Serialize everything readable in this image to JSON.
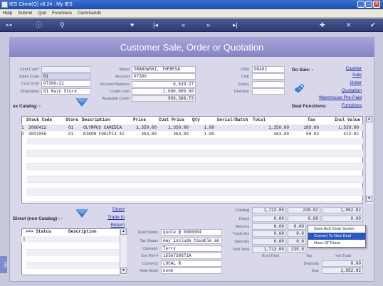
{
  "window": {
    "title": "IES Client(Q) v8.24 : My IES",
    "min": "_",
    "max": "□",
    "close": "×"
  },
  "menu": [
    "Help",
    "Submit",
    "Quit",
    "Functions",
    "Commands"
  ],
  "toolbar_icons": [
    "key-icon",
    "info-icon",
    "search-icon",
    "heart-icon",
    "first-icon",
    "rewind-icon",
    "forward-icon",
    "last-icon",
    "plus-icon",
    "cross-icon",
    "check-icon"
  ],
  "header": {
    "title": "Customer Sale, Order or Quotation"
  },
  "form": {
    "find_cust_label": "Find Cust?",
    "sales_code_label": "Sales Code",
    "sales_code": "01",
    "cust_ord_label": "Cust Ord#",
    "cust_ord": "07306/22",
    "origination_label": "Origination",
    "origination": "01 Main Store",
    "name_label": "Name",
    "name": "GRABOWSKI, THERESA",
    "account_label": "Account",
    "account": "07306",
    "acct_balance_label": "Account Balance",
    "acct_balance": "6,639.27",
    "credit_limit_label": "Credit Limit",
    "credit_limit": "1,000,000.00",
    "available_label": "Available Credit",
    "available": "993,360.73",
    "crm_label": "CRM",
    "crm": "08492",
    "club_label": "Club",
    "expiry_label": "Expiry",
    "directive_label": "Directive"
  },
  "do_sale": {
    "label": "Do Sale: -",
    "links": [
      "Cashier",
      "Sale",
      "Order",
      "Quotation",
      "Warehouse Pre-Paid",
      "Functions"
    ]
  },
  "deal_functions_label": "Deal Functions:",
  "catalog_label": "ex Catalog: -",
  "table": {
    "headers": [
      "Stock Code",
      "Store",
      "Description",
      "Price",
      "Cust Price",
      "Qty",
      "Serial/Batch",
      "Total",
      "Tax",
      "Incl Value"
    ],
    "rows": [
      {
        "n": "1",
        "code": "3008412",
        "store": "01",
        "desc": "OLYMPUS CAMEDIA",
        "price": "1,350.00",
        "cust": "1,350.00",
        "qty": "1.00",
        "total": "1,350.00",
        "tax": "189.00",
        "incl": "1,539.00"
      },
      {
        "n": "2",
        "code": "3007058",
        "store": "01",
        "desc": "NIKON COOLPIX 41",
        "price": "363.00",
        "cust": "363.00",
        "qty": "1.00",
        "total": "363.00",
        "tax": "50.82",
        "incl": "413.82"
      }
    ]
  },
  "direct": {
    "label": "Direct (non Catalog) : -",
    "links": [
      "Direct",
      "Trade In",
      "Return"
    ],
    "headers": [
      ">>> Status",
      "Description"
    ],
    "row1": "1"
  },
  "deal_status": {
    "deal_status_label": "Deal Status",
    "deal_status": "quote @ 0000004",
    "tax_status_label": "Tax Status",
    "tax_status": "may include taxable an",
    "operator_label": "Operator",
    "operator": "Terry",
    "sys_ref_label": "Sys Ref #",
    "sys_ref": "1556738671A",
    "currency_label": "Currency",
    "currency": "LOCAL R",
    "rate_book_label": "Rate Book",
    "rate_book": "none"
  },
  "totals": {
    "catalog_label": "Catalog",
    "catalog": [
      "1,713.00",
      "239.82",
      "1,952.82"
    ],
    "direct_label": "Direct",
    "direct": [
      "0.00",
      "0.00",
      "0.00"
    ],
    "returns_label": "Returns",
    "returns": [
      "0.00",
      "0.00",
      ""
    ],
    "trade_ins_label": "Trade-Ins",
    "trade_ins": [
      "0.00",
      "0.0",
      ""
    ],
    "specials_label": "Specials",
    "specials": [
      "0.00",
      "0.0",
      ""
    ],
    "nett_total_label": "Nett Total",
    "nett_total": [
      "1,713.00",
      "239.8",
      ""
    ],
    "excl_total_label": "Excl Total",
    "tax_label": "Tax",
    "incl_total_label": "Incl Total",
    "deposits_label": "Deposits",
    "deposits": "0.00",
    "due_label": "Due",
    "due": "1,952.82"
  },
  "context_menu": [
    "Save And Clear Screen",
    "Convert To New Deal",
    "None Of These"
  ],
  "side_tab": "Info"
}
